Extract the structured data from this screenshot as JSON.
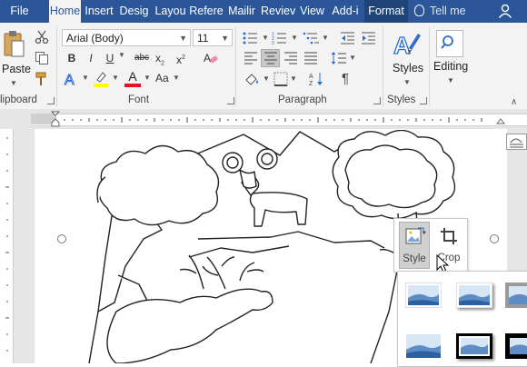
{
  "tabs": [
    {
      "label": "File",
      "active": false
    },
    {
      "label": "Home",
      "active": true
    },
    {
      "label": "Insert",
      "active": false
    },
    {
      "label": "Desig",
      "active": false
    },
    {
      "label": "Layou",
      "active": false
    },
    {
      "label": "Refere",
      "active": false
    },
    {
      "label": "Mailir",
      "active": false
    },
    {
      "label": "Reviev",
      "active": false
    },
    {
      "label": "View",
      "active": false
    },
    {
      "label": "Add-i",
      "active": false
    },
    {
      "label": "Format",
      "active": false
    }
  ],
  "tell_me": "Tell me",
  "clipboard": {
    "paste_label": "Paste",
    "group_label": "lipboard"
  },
  "font": {
    "font_name": "Arial (Body)",
    "font_size": "11",
    "group_label": "Font",
    "bold": "B",
    "italic": "I",
    "underline": "U",
    "strike": "abc",
    "subscript": "x",
    "superscript": "x",
    "font_color_letter": "A",
    "change_case": "Aa"
  },
  "paragraph": {
    "group_label": "Paragraph"
  },
  "styles": {
    "label": "Styles",
    "group_label": "Styles"
  },
  "editing": {
    "label": "Editing"
  },
  "picture_popup": {
    "style_label": "Style",
    "crop_label": "Crop"
  },
  "colors": {
    "brand": "#2b579a",
    "ribbon": "#f3f3f3",
    "highlight_yellow": "#ffff00",
    "font_red": "#e81123"
  }
}
